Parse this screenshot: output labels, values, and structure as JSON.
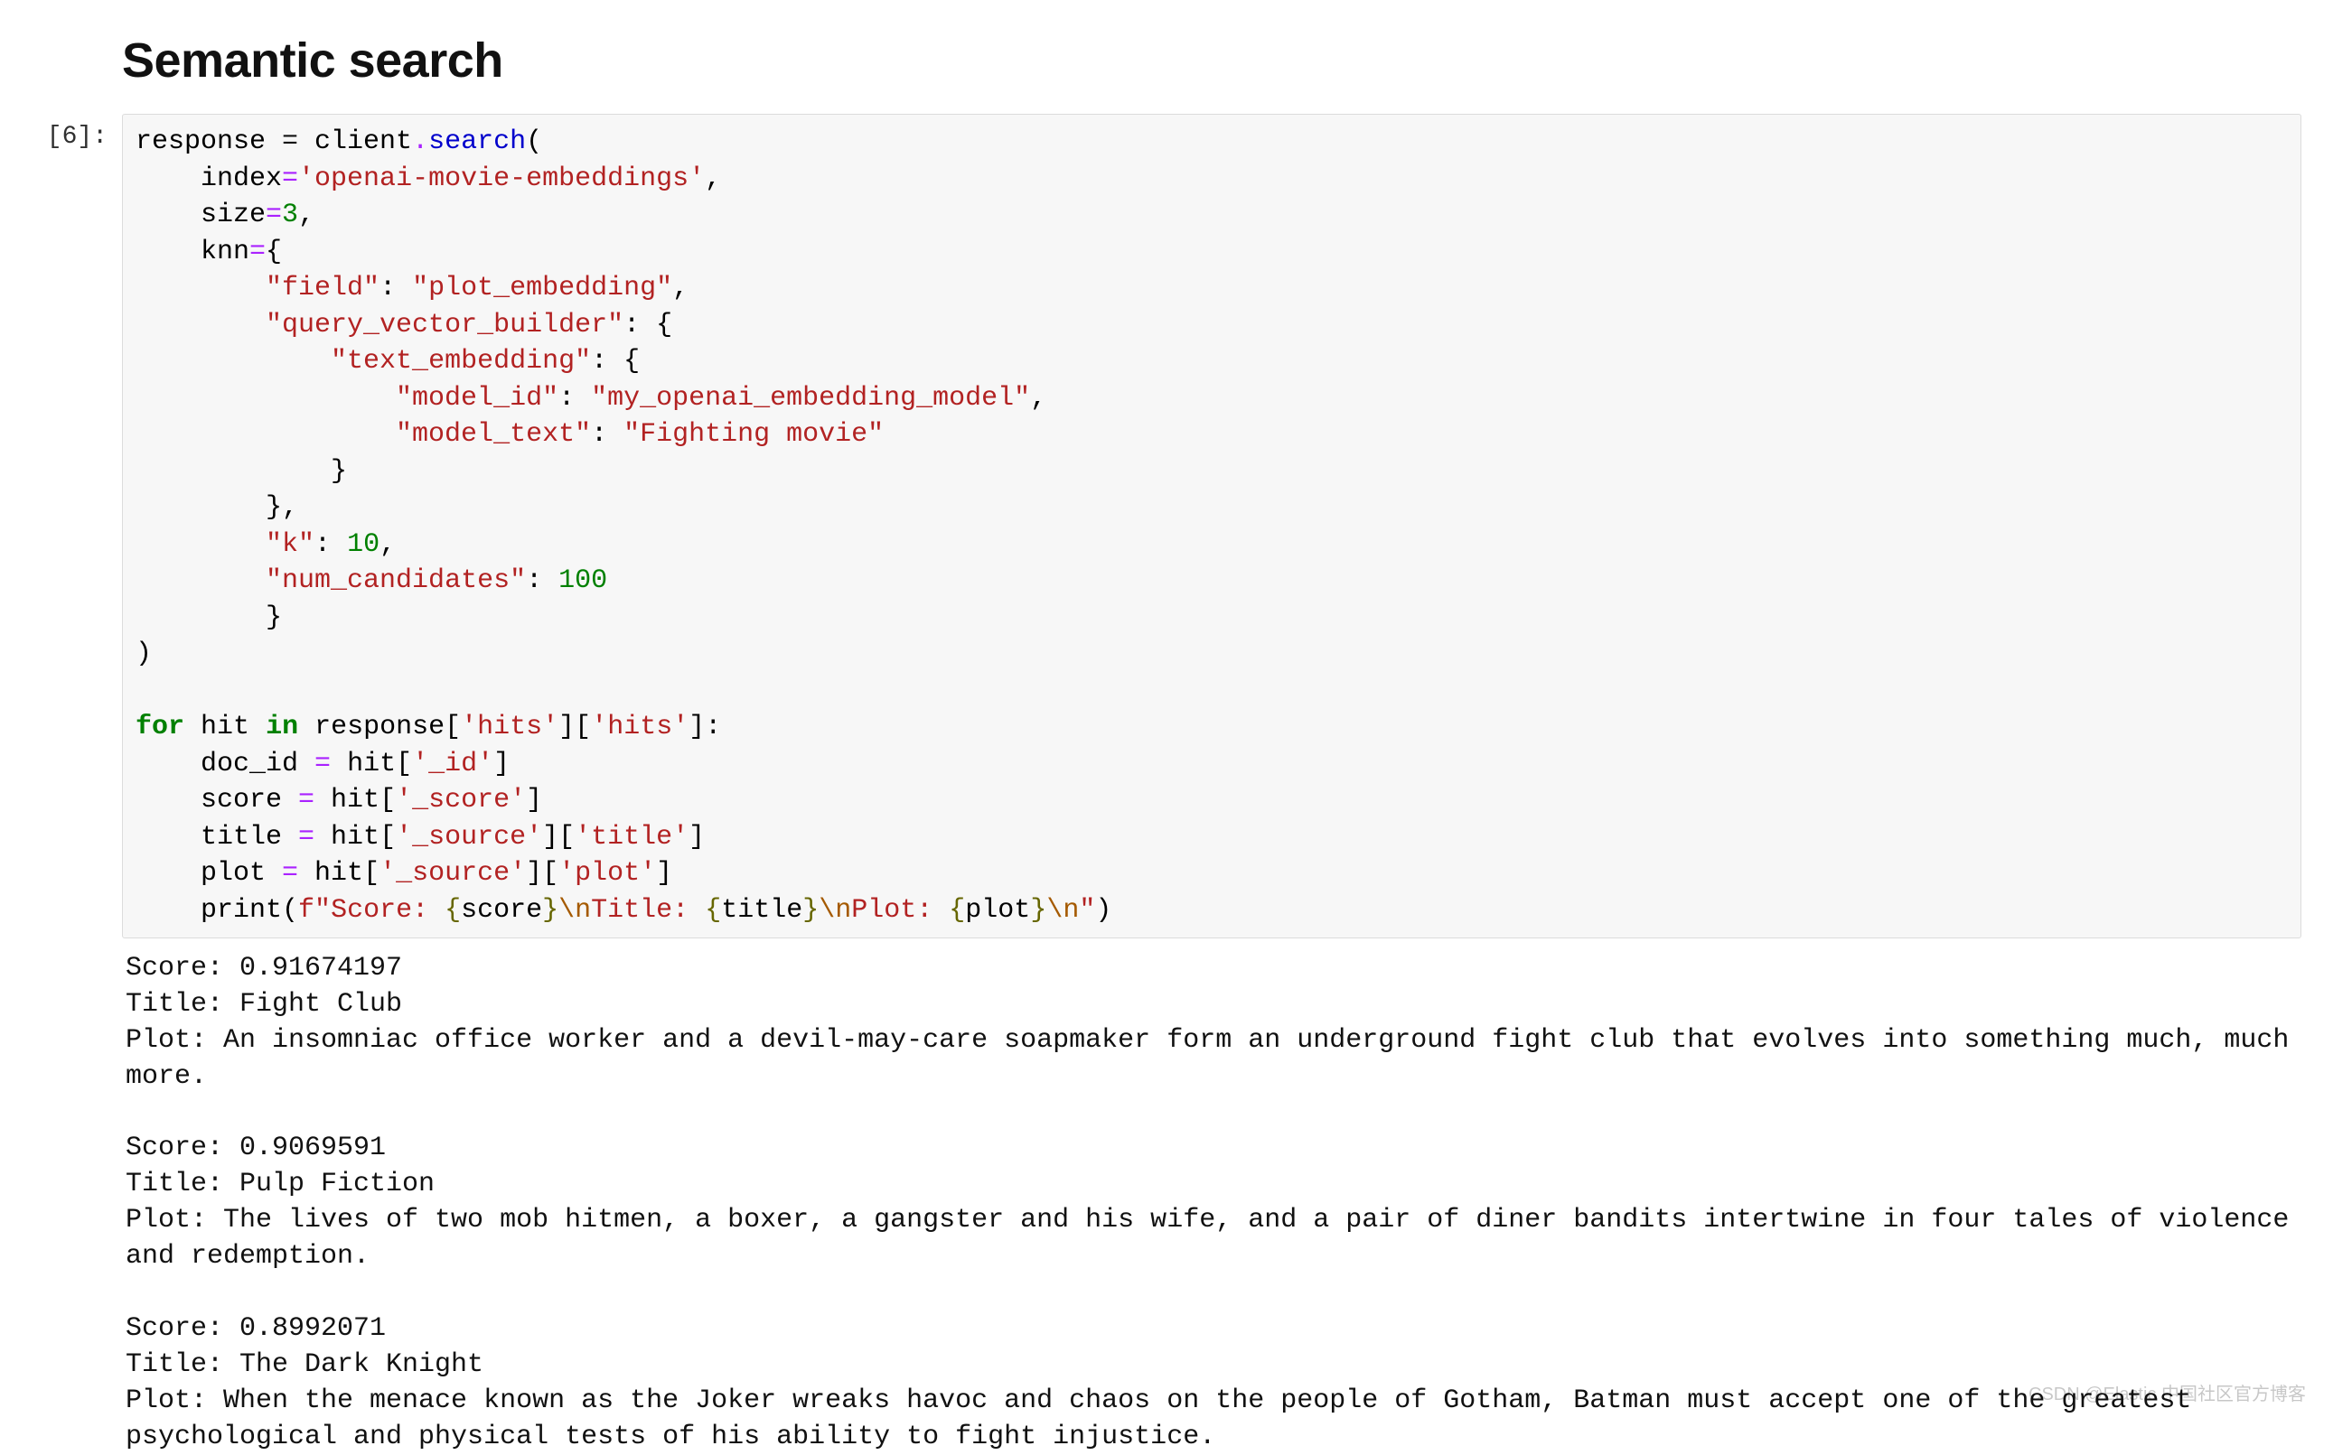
{
  "heading": "Semantic search",
  "prompt_label": "[6]:",
  "code": {
    "assign_lhs": "response",
    "equals": " = ",
    "object": "client",
    "dot": ".",
    "method": "search",
    "p_index_kw": "index",
    "p_index_val": "'openai-movie-embeddings'",
    "p_size_kw": "size",
    "p_size_val": "3",
    "p_knn_kw": "knn",
    "knn_field_key": "\"field\"",
    "knn_field_val": "\"plot_embedding\"",
    "knn_qvb_key": "\"query_vector_builder\"",
    "te_key": "\"text_embedding\"",
    "te_modelid_key": "\"model_id\"",
    "te_modelid_val": "\"my_openai_embedding_model\"",
    "te_modeltext_key": "\"model_text\"",
    "te_modeltext_val": "\"Fighting movie\"",
    "knn_k_key": "\"k\"",
    "knn_k_val": "10",
    "knn_nc_key": "\"num_candidates\"",
    "knn_nc_val": "100",
    "for_kw": "for",
    "in_kw": "in",
    "loop_var": "hit",
    "loop_iter_obj": "response",
    "idx_hits1": "'hits'",
    "idx_hits2": "'hits'",
    "l1_lhs": "doc_id",
    "l1_rhs_obj": "hit",
    "l1_idx": "'_id'",
    "l2_lhs": "score",
    "l2_rhs_obj": "hit",
    "l2_idx": "'_score'",
    "l3_lhs": "title",
    "l3_rhs_obj": "hit",
    "l3_idx1": "'_source'",
    "l3_idx2": "'title'",
    "l4_lhs": "plot",
    "l4_rhs_obj": "hit",
    "l4_idx1": "'_source'",
    "l4_idx2": "'plot'",
    "print_fn": "print",
    "f_prefix": "f\"",
    "f_score_lit": "Score: ",
    "f_score_var": "score",
    "f_nl1": "\\n",
    "f_title_lit": "Title: ",
    "f_title_var": "title",
    "f_nl2": "\\n",
    "f_plot_lit": "Plot: ",
    "f_plot_var": "plot",
    "f_nl3": "\\n",
    "f_suffix": "\""
  },
  "output_lines": [
    "Score: 0.91674197",
    "Title: Fight Club",
    "Plot: An insomniac office worker and a devil-may-care soapmaker form an underground fight club that evolves into something much, much more.",
    "",
    "Score: 0.9069591",
    "Title: Pulp Fiction",
    "Plot: The lives of two mob hitmen, a boxer, a gangster and his wife, and a pair of diner bandits intertwine in four tales of violence and redemption.",
    "",
    "Score: 0.8992071",
    "Title: The Dark Knight",
    "Plot: When the menace known as the Joker wreaks havoc and chaos on the people of Gotham, Batman must accept one of the greatest psychological and physical tests of his ability to fight injustice."
  ],
  "watermark": "CSDN @Elastic 中国社区官方博客"
}
